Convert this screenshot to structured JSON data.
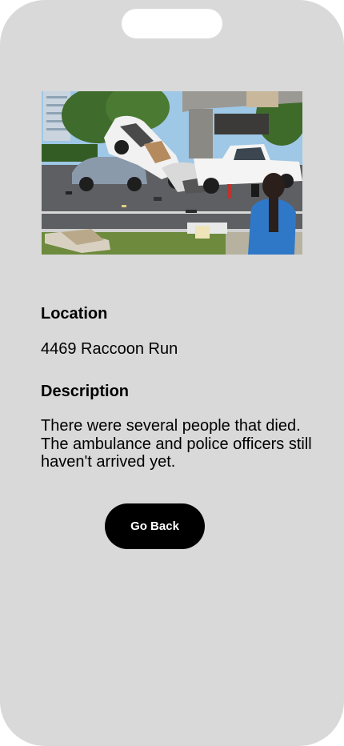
{
  "screen": {
    "background": "#d9d9d9",
    "notch_color": "#ffffff"
  },
  "incident_photo": {
    "alt": "Car crash scene"
  },
  "location": {
    "heading": "Location",
    "value": "4469 Raccoon Run"
  },
  "description": {
    "heading": "Description",
    "value": "There were several people that died. The ambulance and police officers still haven't arrived yet."
  },
  "actions": {
    "back_label": "Go Back",
    "back_button_color": "#000000"
  }
}
